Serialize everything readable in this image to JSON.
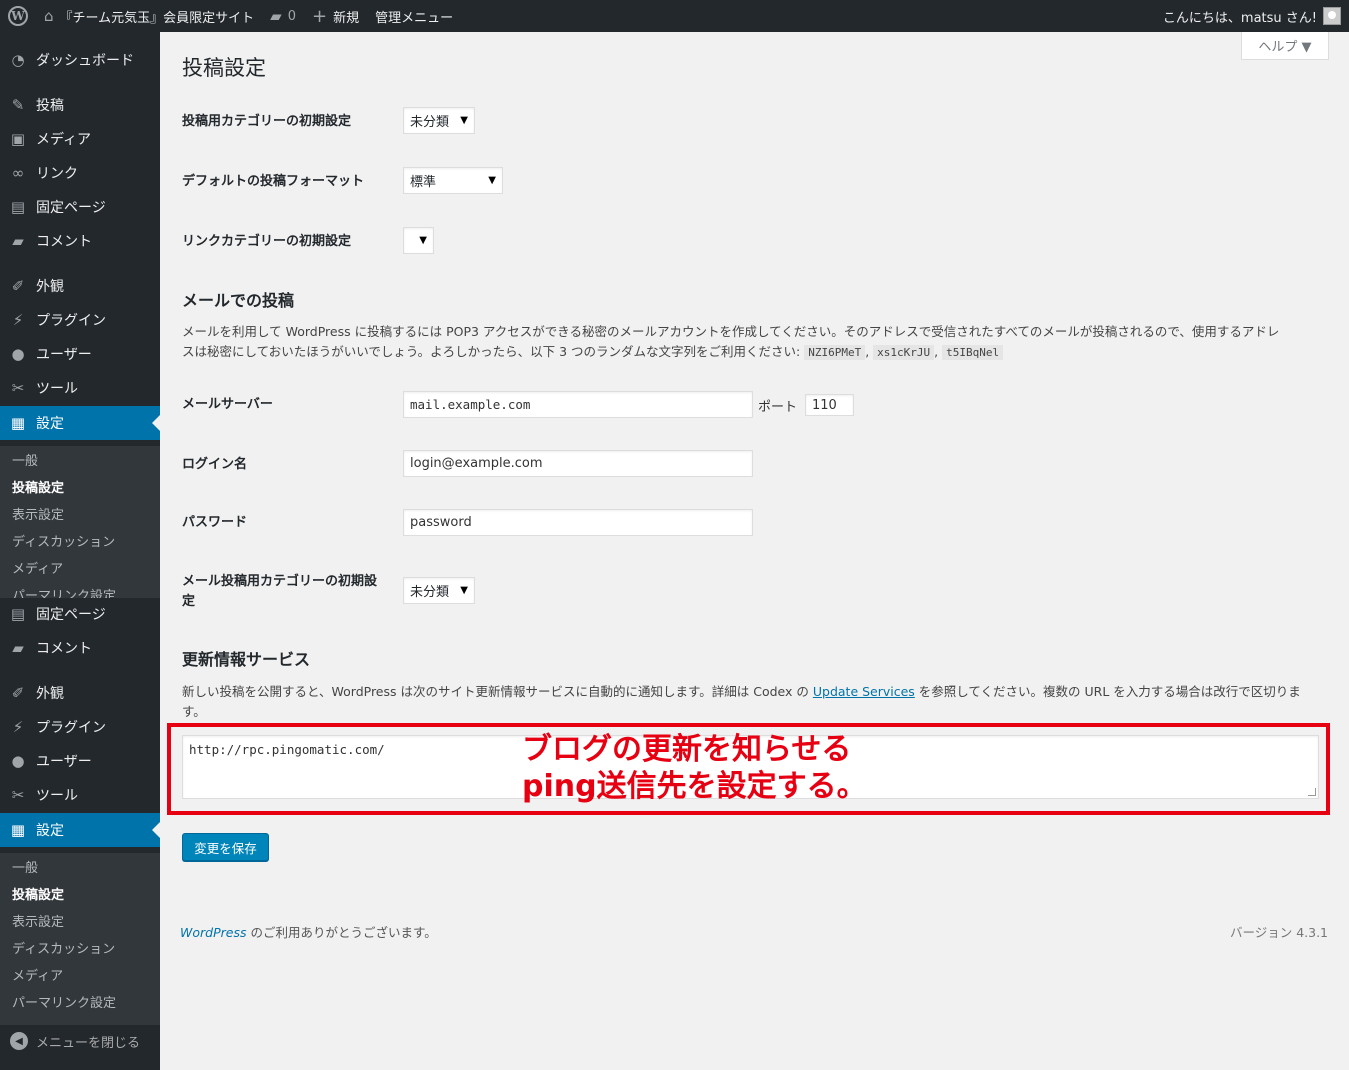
{
  "adminbar": {
    "site_name": "『チーム元気玉』会員限定サイト",
    "comments_count": "0",
    "new_label": "新規",
    "manage_menu": "管理メニュー",
    "greeting": "こんにちは、matsu さん!"
  },
  "sidebar": {
    "dashboard": "ダッシュボード",
    "posts": "投稿",
    "media": "メディア",
    "links": "リンク",
    "pages": "固定ページ",
    "comments": "コメント",
    "appearance": "外観",
    "plugins": "プラグイン",
    "users": "ユーザー",
    "tools": "ツール",
    "settings": "設定",
    "sub": {
      "general": "一般",
      "writing": "投稿設定",
      "reading": "表示設定",
      "discussion": "ディスカッション",
      "media": "メディア",
      "permalinks": "パーマリンク設定"
    },
    "collapse": "メニューを閉じる"
  },
  "help_tab": "ヘルプ ▼",
  "page_title": "投稿設定",
  "default_category": {
    "label": "投稿用カテゴリーの初期設定",
    "value": "未分類"
  },
  "default_format": {
    "label": "デフォルトの投稿フォーマット",
    "value": "標準"
  },
  "link_category": {
    "label": "リンクカテゴリーの初期設定",
    "value": ""
  },
  "post_via_email": {
    "heading": "メールでの投稿",
    "desc_1": "メールを利用して WordPress に投稿するには POP3 アクセスができる秘密のメールアカウントを作成してください。そのアドレスで受信されたすべてのメールが投稿されるので、使用するアドレ",
    "desc_2": "スは秘密にしておいたほうがいいでしょう。よろしかったら、以下 3 つのランダムな文字列をご利用ください: ",
    "code_1": "NZI6PMeT",
    "code_2": "xs1cKrJU",
    "code_3": "t5IBqNel",
    "sep": ", "
  },
  "mail_server": {
    "label": "メールサーバー",
    "value": "mail.example.com",
    "port_label": "ポート",
    "port_value": "110"
  },
  "login_name": {
    "label": "ログイン名",
    "value": "login@example.com"
  },
  "password": {
    "label": "パスワード",
    "value": "password"
  },
  "mail_category": {
    "label": "メール投稿用カテゴリーの初期設定",
    "value": "未分類"
  },
  "update_services": {
    "heading": "更新情報サービス",
    "desc_pre": "新しい投稿を公開すると、WordPress は次のサイト更新情報サービスに自動的に通知します。詳細は Codex の ",
    "desc_link": "Update Services",
    "desc_post": " を参照してください。複数の URL を入力する場合は改行で区切りま",
    "desc_line2": "す。",
    "textarea_value": "http://rpc.pingomatic.com/"
  },
  "annotation": "ブログの更新を知らせる\nping送信先を設定する。",
  "save_button": "変更を保存",
  "footer": {
    "wp": "WordPress",
    "thanks": " のご利用ありがとうございます。",
    "version": "バージョン 4.3.1"
  },
  "colors": {
    "accent": "#0073aa",
    "annotation_red": "#e60012",
    "button": "#0085ba"
  }
}
